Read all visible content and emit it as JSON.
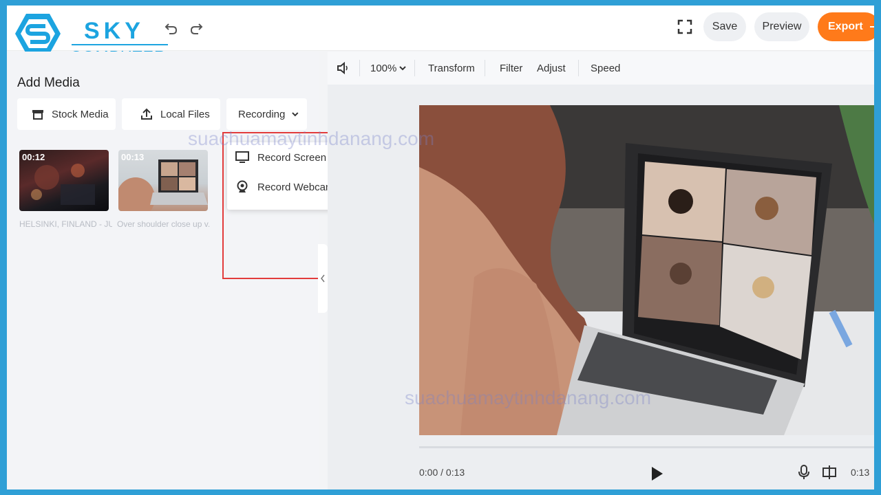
{
  "header": {
    "logo_line1": "SKY",
    "logo_line2": "COMPUTER",
    "save_label": "Save",
    "preview_label": "Preview",
    "export_label": "Export",
    "brand_color": "#1ca4e0",
    "export_color": "#ff7a1a"
  },
  "sidebar": {
    "title": "Add Media",
    "buttons": {
      "stock": "Stock Media",
      "local": "Local Files",
      "recording": "Recording"
    },
    "dropdown": {
      "record_screen": "Record Screen",
      "record_webcam": "Record Webcam"
    },
    "media": [
      {
        "duration": "00:12",
        "caption": "HELSINKI, FINLAND - JU..."
      },
      {
        "duration": "00:13",
        "caption": "Over shoulder close up v..."
      }
    ]
  },
  "toolbar": {
    "zoom": "100%",
    "transform": "Transform",
    "filter": "Filter",
    "adjust": "Adjust",
    "speed": "Speed"
  },
  "player": {
    "time_current": "0:00 / 0:13",
    "time_end": "0:13",
    "progress": 0.0
  },
  "watermark": {
    "text": "suachuamaytinhdanang.com"
  },
  "icons": [
    "undo-icon",
    "redo-icon",
    "fullscreen-icon",
    "store-icon",
    "upload-icon",
    "chevron-down-icon",
    "monitor-icon",
    "webcam-icon",
    "volume-icon",
    "play-icon",
    "mic-icon",
    "split-icon",
    "chevron-left-icon",
    "arrow-right-icon"
  ]
}
